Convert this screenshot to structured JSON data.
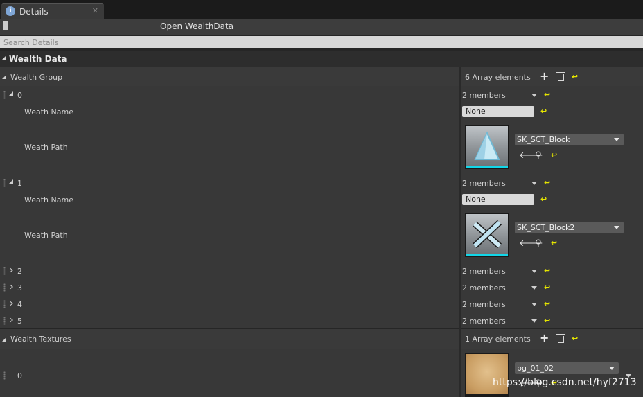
{
  "tab": {
    "title": "Details",
    "close": "✕"
  },
  "header": {
    "open_link": "Open WealthData"
  },
  "search": {
    "placeholder": "Search Details"
  },
  "category": {
    "label": "Wealth Data"
  },
  "wealth_group": {
    "label": "Wealth Group",
    "count": "6 Array elements",
    "elements": [
      {
        "index": "0",
        "summary": "2 members",
        "name_label": "Weath Name",
        "name_value": "None",
        "path_label": "Weath Path",
        "path_value": "SK_SCT_Block"
      },
      {
        "index": "1",
        "summary": "2 members",
        "name_label": "Weath Name",
        "name_value": "None",
        "path_label": "Weath Path",
        "path_value": "SK_SCT_Block2"
      },
      {
        "index": "2",
        "summary": "2 members"
      },
      {
        "index": "3",
        "summary": "2 members"
      },
      {
        "index": "4",
        "summary": "2 members"
      },
      {
        "index": "5",
        "summary": "2 members"
      }
    ]
  },
  "wealth_textures": {
    "label": "Wealth Textures",
    "count": "1 Array elements",
    "elements": [
      {
        "index": "0",
        "value": "bg_01_02"
      }
    ]
  },
  "icons": {
    "reset": "reset-to-default-icon",
    "add": "plus-icon",
    "delete": "trash-icon",
    "browse": "back-arrow-icon",
    "find": "magnifier-icon"
  },
  "colors": {
    "thumb_underline": "#12d6e8",
    "reset_arrow": "#e6e600"
  },
  "watermark": "https://blog.csdn.net/hyf2713"
}
